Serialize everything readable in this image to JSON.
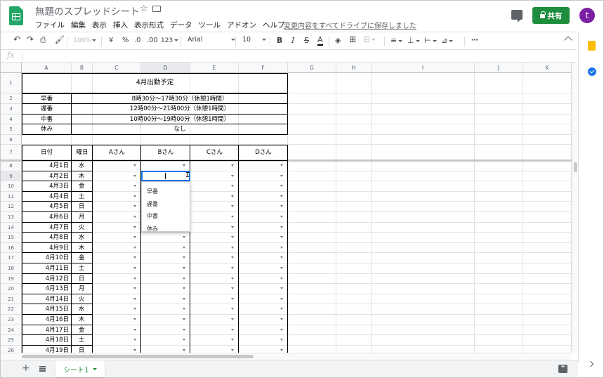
{
  "header": {
    "title": "無題のスプレッドシート",
    "menu": [
      "ファイル",
      "編集",
      "表示",
      "挿入",
      "表示形式",
      "データ",
      "ツール",
      "アドオン",
      "ヘルプ"
    ],
    "saved_status": "変更内容をすべてドライブに保存しました",
    "share_label": "共有",
    "avatar_letter": "t"
  },
  "toolbar": {
    "zoom": "100%",
    "currency": "¥",
    "percent": "%",
    "dec_less": ".0",
    "dec_more": ".00",
    "format_more": "123",
    "font": "Arial",
    "size": "10",
    "bold": "B",
    "italic": "I",
    "text_color": "A"
  },
  "formula_bar": {
    "fx": "fx"
  },
  "columns": [
    "A",
    "B",
    "C",
    "D",
    "E",
    "F",
    "G",
    "H",
    "I",
    "J",
    "K"
  ],
  "rows": [
    "1",
    "2",
    "3",
    "4",
    "5",
    "6",
    "7",
    "8",
    "9",
    "10",
    "11",
    "12",
    "13",
    "14",
    "15",
    "16",
    "17",
    "18",
    "19",
    "20",
    "21",
    "22",
    "23",
    "24",
    "25",
    "26"
  ],
  "sheet": {
    "title": "4月出勤予定",
    "legend": [
      {
        "shift": "早番",
        "time": "8時30分～17時30分（休憩1時間）"
      },
      {
        "shift": "遅番",
        "time": "12時00分～21時00分（休憩1時間）"
      },
      {
        "shift": "中番",
        "time": "10時00分～19時00分（休憩1時間）"
      },
      {
        "shift": "休み",
        "time": "なし"
      }
    ],
    "table_headers": [
      "日付",
      "曜日",
      "Aさん",
      "Bさん",
      "Cさん",
      "Dさん"
    ],
    "days": [
      {
        "date": "4月1日",
        "dow": "水"
      },
      {
        "date": "4月2日",
        "dow": "木"
      },
      {
        "date": "4月3日",
        "dow": "金"
      },
      {
        "date": "4月4日",
        "dow": "土"
      },
      {
        "date": "4月5日",
        "dow": "日"
      },
      {
        "date": "4月6日",
        "dow": "月"
      },
      {
        "date": "4月7日",
        "dow": "火"
      },
      {
        "date": "4月8日",
        "dow": "水"
      },
      {
        "date": "4月9日",
        "dow": "木"
      },
      {
        "date": "4月10日",
        "dow": "金"
      },
      {
        "date": "4月11日",
        "dow": "土"
      },
      {
        "date": "4月12日",
        "dow": "日"
      },
      {
        "date": "4月13日",
        "dow": "月"
      },
      {
        "date": "4月14日",
        "dow": "火"
      },
      {
        "date": "4月15日",
        "dow": "水"
      },
      {
        "date": "4月16日",
        "dow": "木"
      },
      {
        "date": "4月17日",
        "dow": "金"
      },
      {
        "date": "4月18日",
        "dow": "土"
      },
      {
        "date": "4月19日",
        "dow": "日"
      }
    ]
  },
  "dropdown": {
    "options": [
      "早番",
      "遅番",
      "中番",
      "休み"
    ]
  },
  "bottom": {
    "sheet_tab": "シート1"
  },
  "colors": {
    "accent": "#1a73e8",
    "share": "#1e8e3e",
    "avatar": "#7b1fa2"
  }
}
